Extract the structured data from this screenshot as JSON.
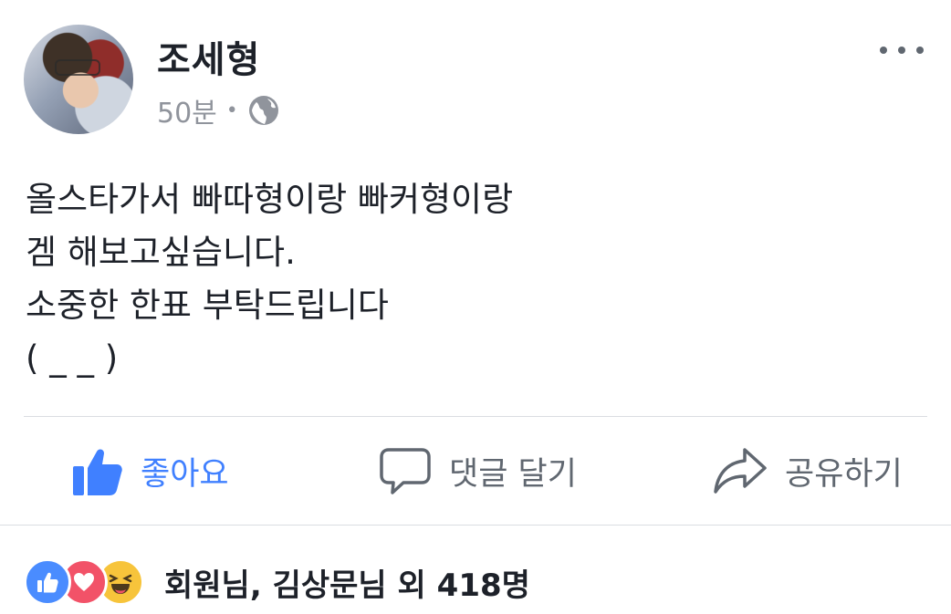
{
  "post": {
    "author": "조세형",
    "time": "50분",
    "separator": "•",
    "privacy_icon": "globe-icon",
    "lines": [
      "올스타가서 빠따형이랑 빠커형이랑",
      "겜 해보고싶습니다.",
      "소중한 한표 부탁드립니다",
      "( _ _ )"
    ]
  },
  "actions": {
    "like": "좋아요",
    "comment": "댓글 달기",
    "share": "공유하기"
  },
  "reactions": {
    "icons": [
      "like-reaction-icon",
      "love-reaction-icon",
      "haha-reaction-icon"
    ],
    "text": "회원님, 김상문님 외 418명"
  },
  "colors": {
    "accent": "#4080ff",
    "muted": "#606770",
    "love": "#f25268",
    "haha": "#f7c43b"
  }
}
